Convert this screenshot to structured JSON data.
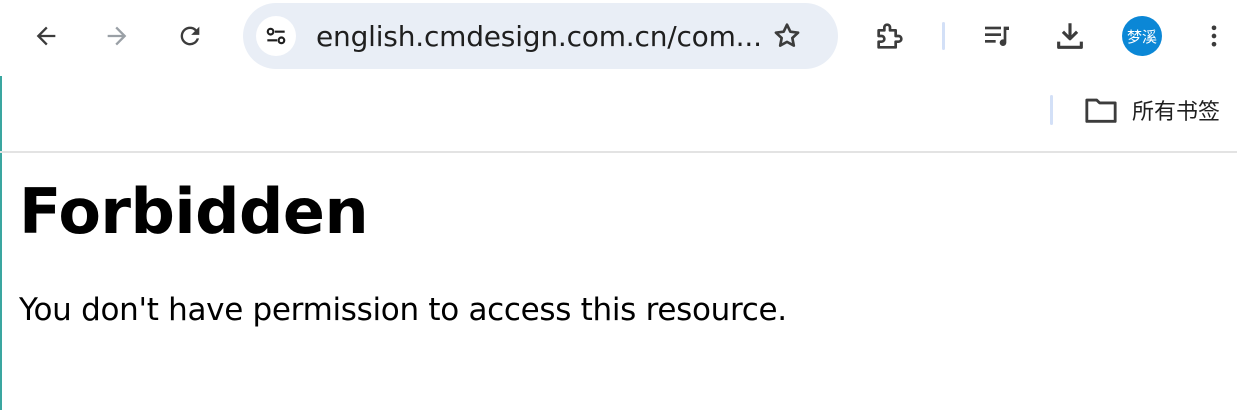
{
  "browser": {
    "url_display": "english.cmdesign.com.cn/com...",
    "profile_initials": "梦溪",
    "icons": [
      "back-icon",
      "forward-icon",
      "reload-icon",
      "site-info-icon",
      "star-icon",
      "extensions-icon",
      "media-controls-icon",
      "download-icon",
      "more-menu-icon",
      "folder-icon"
    ],
    "colors": {
      "omnibox_bg": "#e9eef6",
      "avatar_bg": "#0b87d6",
      "separator": "#d3e0f7"
    }
  },
  "bookmarks": {
    "all_bookmarks_label": "所有书签"
  },
  "page": {
    "title": "Forbidden",
    "message": "You don't have permission to access this resource."
  }
}
